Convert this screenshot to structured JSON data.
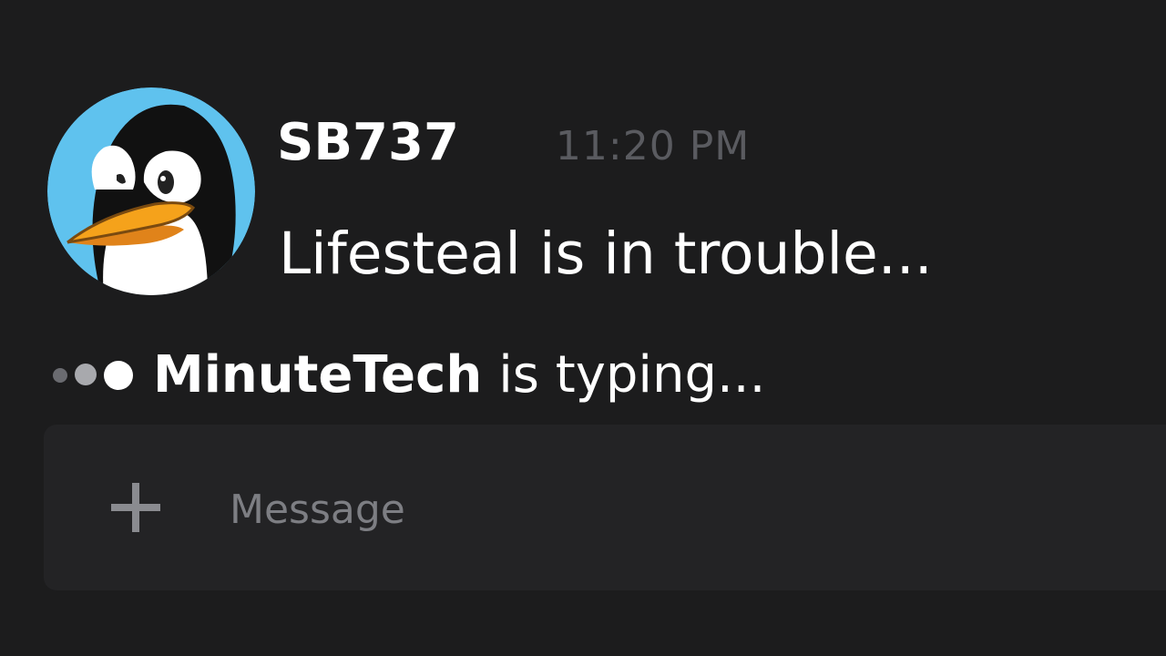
{
  "message": {
    "author": "SB737",
    "timestamp": "11:20 PM",
    "content": "Lifesteal is in trouble...",
    "avatar_icon": "penguin-avatar"
  },
  "typing_indicator": {
    "user": "MinuteTech",
    "text": "is typing..."
  },
  "composer": {
    "add_icon": "plus-icon",
    "placeholder": "Message",
    "value": ""
  },
  "colors": {
    "background": "#1c1c1d",
    "composer_background": "#232325",
    "timestamp": "#5a5b60",
    "placeholder": "#7d7e83",
    "avatar_blue": "#5fc2ee",
    "beak_orange": "#f5a21b"
  }
}
